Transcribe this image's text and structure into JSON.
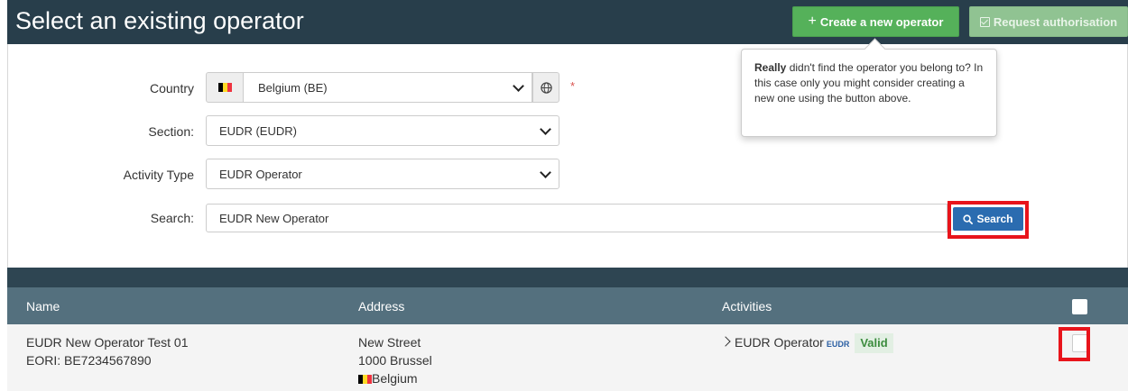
{
  "header": {
    "title": "Select an existing operator",
    "create_label": "Create a new operator",
    "request_label": "Request authorisation"
  },
  "form": {
    "country_label": "Country",
    "country_value": "Belgium (BE)",
    "required_mark": "*",
    "section_label": "Section:",
    "section_value": "EUDR (EUDR)",
    "activity_label": "Activity Type",
    "activity_value": "EUDR Operator",
    "search_label": "Search:",
    "search_value": "EUDR New Operator",
    "search_button": "Search"
  },
  "tooltip": {
    "bold": "Really",
    "text": " didn't find the operator you belong to? In this case only you might consider creating a new one using the button above."
  },
  "table": {
    "headers": {
      "name": "Name",
      "address": "Address",
      "activities": "Activities"
    },
    "rows": [
      {
        "name": "EUDR New Operator Test 01",
        "eori": "EORI: BE7234567890",
        "street": "New Street",
        "city": "1000 Brussel",
        "country": "Belgium",
        "activity": "EUDR Operator",
        "activity_tag": "EUDR",
        "status": "Valid"
      }
    ]
  },
  "colors": {
    "header_bg": "#283e4b",
    "create_button": "#55b15a",
    "search_button": "#2b6cb0",
    "table_header": "#54707e",
    "highlight_border": "#e8141b"
  },
  "icons": [
    "plus-icon",
    "check-square-icon",
    "belgium-flag-icon",
    "globe-icon",
    "search-icon",
    "chevron-down-icon",
    "chevron-right-icon"
  ]
}
